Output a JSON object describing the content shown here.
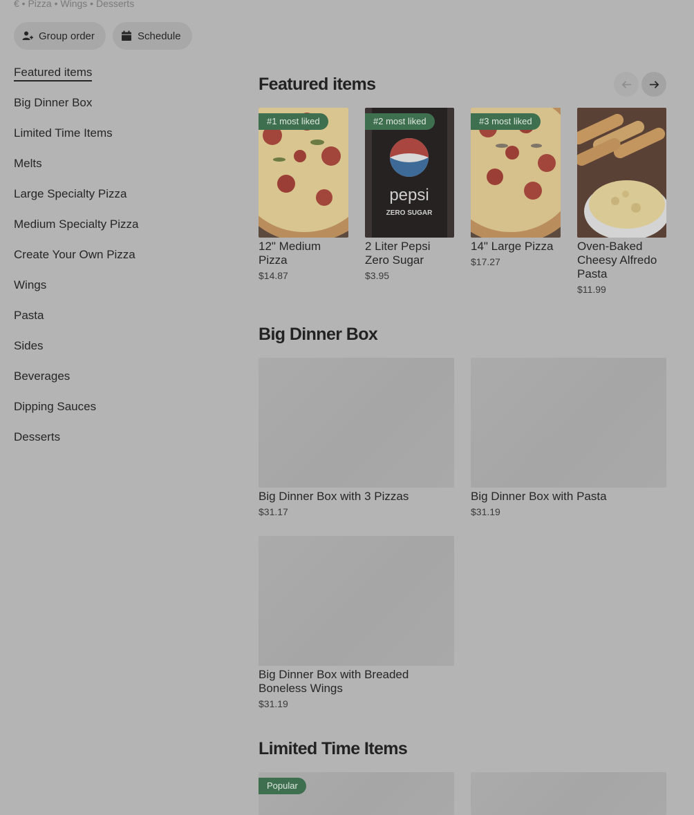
{
  "store": {
    "tagline": "€ • Pizza • Wings • Desserts"
  },
  "actions": {
    "group_order": "Group order",
    "schedule": "Schedule"
  },
  "sidebar": {
    "items": [
      "Featured items",
      "Big Dinner Box",
      "Limited Time Items",
      "Melts",
      "Large Specialty Pizza",
      "Medium Specialty Pizza",
      "Create Your Own Pizza",
      "Wings",
      "Pasta",
      "Sides",
      "Beverages",
      "Dipping Sauces",
      "Desserts"
    ]
  },
  "featured": {
    "title": "Featured items",
    "items": [
      {
        "badge": "#1 most liked",
        "name": "12\" Medium Pizza",
        "price": "$14.87",
        "image": "pepperoni-pizza"
      },
      {
        "badge": "#2 most liked",
        "name": "2 Liter Pepsi Zero Sugar",
        "price": "$3.95",
        "image": "pepsi-bottle",
        "label_brand": "pepsi",
        "label_sub": "ZERO SUGAR"
      },
      {
        "badge": "#3 most liked",
        "name": "14\" Large Pizza",
        "price": "$17.27",
        "image": "pepperoni-pizza"
      },
      {
        "name": "Oven-Baked Cheesy Alfredo Pasta",
        "price": "$11.99",
        "image": "pasta-breadsticks"
      }
    ]
  },
  "big_dinner_box": {
    "title": "Big Dinner Box",
    "items": [
      {
        "name": "Big Dinner Box with 3 Pizzas",
        "price": "$31.17"
      },
      {
        "name": "Big Dinner Box with Pasta",
        "price": "$31.19"
      },
      {
        "name": "Big Dinner Box with Breaded Boneless Wings",
        "price": "$31.19"
      }
    ]
  },
  "limited_time": {
    "title": "Limited Time Items",
    "items": [
      {
        "badge": "Popular"
      },
      {}
    ]
  },
  "colors": {
    "badge": "#3e7050",
    "overlay_bg": "#b4b4b4",
    "text": "#262626"
  }
}
